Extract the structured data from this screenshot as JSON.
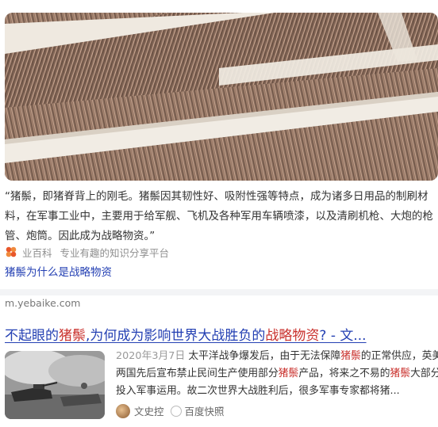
{
  "result1": {
    "quote_lines": [
      "“猪鬃，即猪脊背上的刚毛。猪鬃因其韧性好、吸附性强等特点，成为诸多日用品的制刷材",
      "料，在军事工业中，主要用于给军舰、飞机及各种军用车辆喷漆，以及清刷机枪、大炮的枪",
      "管、炮筒。因此成为战略物资。”"
    ],
    "source_name": "业百科",
    "source_desc": "专业有趣的知识分享平台",
    "link_text": "猪鬃为什么是战略物资"
  },
  "result2": {
    "domain": "m.yebaike.com",
    "title_parts": [
      "不起眼的",
      "猪鬃",
      ",为何成为影响世界大战胜负的",
      "战略物资",
      "? - 文..."
    ],
    "snippet": {
      "date": "2020年3月7日",
      "line1_a": " 太平洋战争爆发后，由于无法保障",
      "line1_hl": "猪鬃",
      "line1_b": "的正常供应，英美",
      "line2_a": "两国先后宣布禁止民间生产使用部分",
      "line2_hl1": "猪鬃",
      "line2_b": "产品，将来之不易的",
      "line2_hl2": "猪鬃",
      "line2_c": "大部分",
      "line3": "投入军事运用。故二次世界大战胜利后，很多军事专家都将猪..."
    },
    "author": "文史控",
    "platform": "百度快照"
  },
  "colors": {
    "link": "#2440b3",
    "highlight": "#c9302c"
  },
  "icons": {
    "source_logo": "baike-logo-icon",
    "author_avatar": "avatar-icon",
    "platform": "baidu-paw-icon"
  }
}
